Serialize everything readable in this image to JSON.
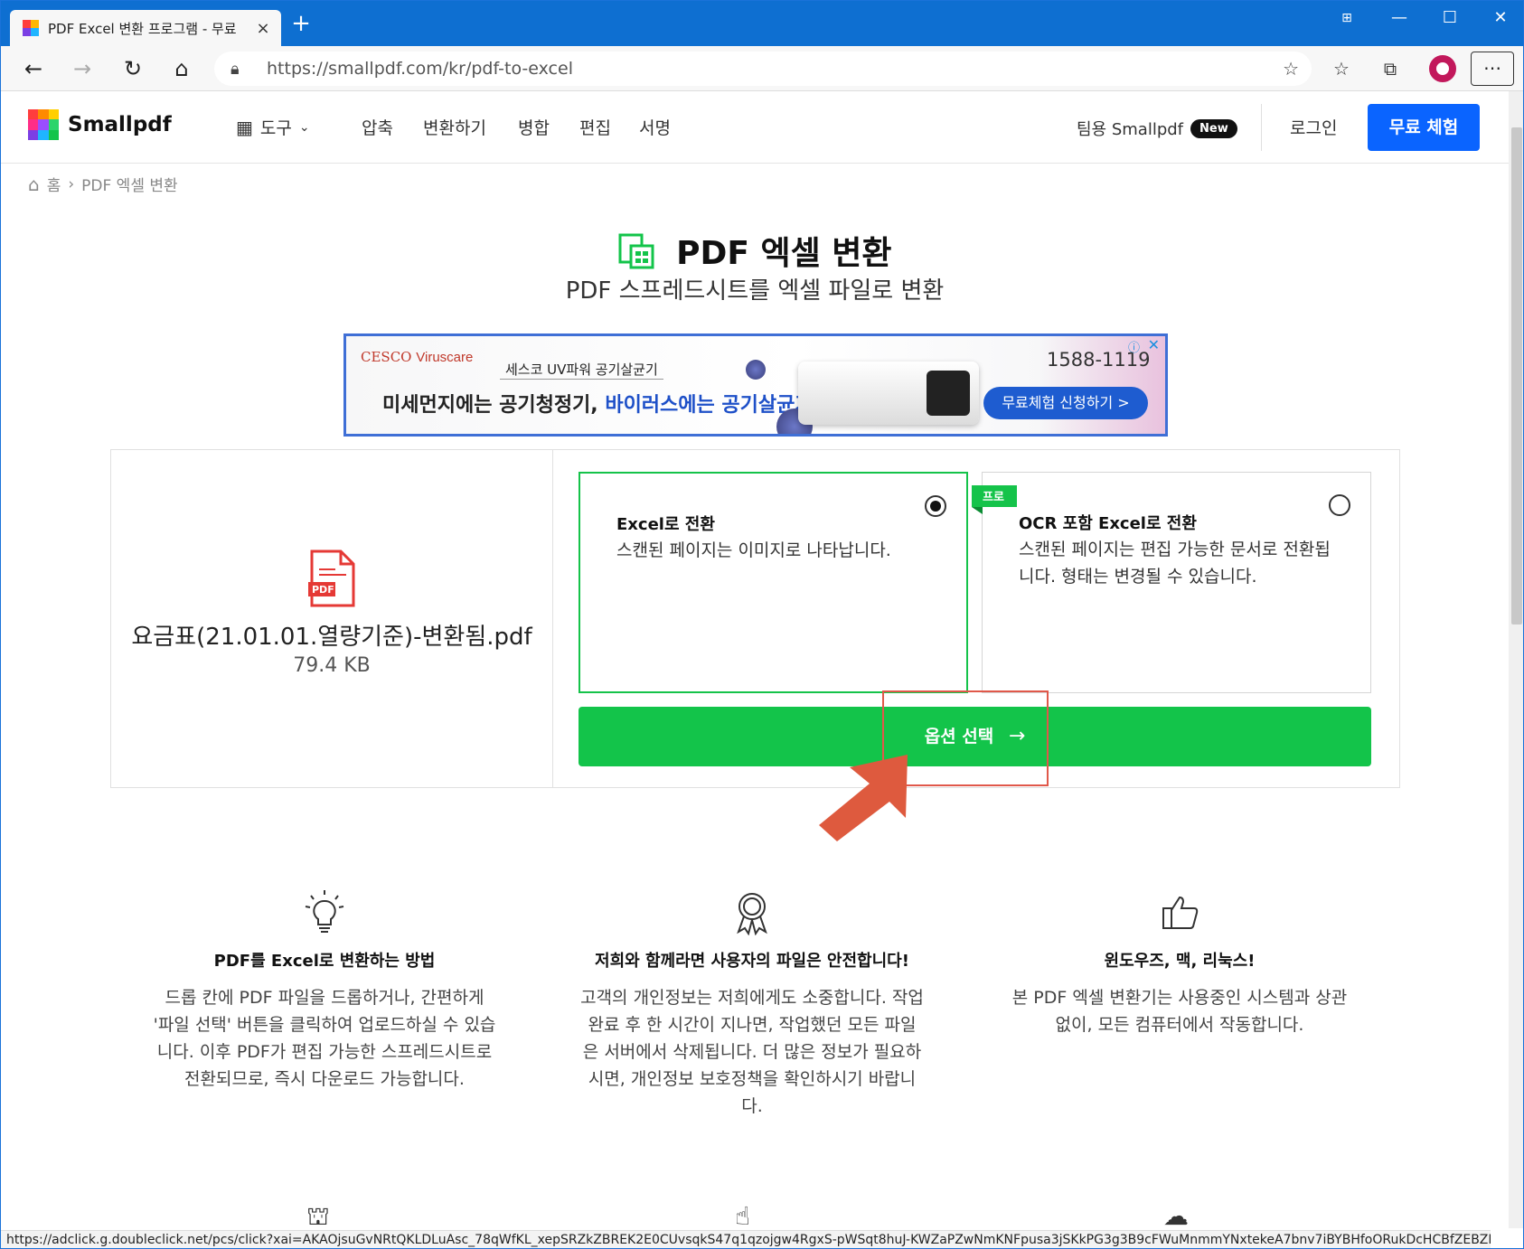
{
  "browser": {
    "tab_title": "PDF Excel 변환 프로그램 - 무료",
    "tab_close": "×",
    "new_tab": "+",
    "url": "https://smallpdf.com/kr/pdf-to-excel",
    "status_url": "https://adclick.g.doubleclick.net/pcs/click?xai=AKAOjsuGvNRtQKLDLuAsc_78qWfKL_xepSRZkZBREK2E0CUvsqkS47q1qzojgw4RgxS-pWSqt8huJ-KWZaPZwNmKNFpusa3jSKkPG3g3B9cFWuMnmmYNxtekeA7bnv7iBYBHfoORukDcHCBfZEBZMgAuMo..."
  },
  "header": {
    "logo_text": "Smallpdf",
    "nav": {
      "tools": "도구",
      "compress": "압축",
      "convert": "변환하기",
      "merge": "병합",
      "edit": "편집",
      "sign": "서명"
    },
    "team": "팀용 Smallpdf",
    "team_badge": "New",
    "login": "로그인",
    "trial": "무료 체험"
  },
  "breadcrumb": {
    "home": "홈",
    "sep": "›",
    "current": "PDF 엑셀 변환"
  },
  "hero": {
    "title": "PDF 엑셀 변환",
    "subtitle": "PDF 스프레드시트를 엑셀 파일로 변환"
  },
  "ad": {
    "brand": "CESCO",
    "brand_sub": "Viruscare",
    "tag": "세스코 UV파워 공기살균기",
    "headline_a": "미세먼지에는 공기청정기, ",
    "headline_b": "바이러스에는 공기살균기!",
    "phone": "1588-1119",
    "cta": "무료체험 신청하기 >",
    "adchoice": "ⓘ",
    "close": "✕"
  },
  "file": {
    "name": "요금표(21.01.01.열량기준)-변환됨.pdf",
    "size": "79.4 KB",
    "icon_label": "PDF"
  },
  "options": [
    {
      "title": "Excel로 전환",
      "desc": "스캔된 페이지는 이미지로 나타납니다.",
      "selected": true
    },
    {
      "badge": "프로",
      "title": "OCR 포함 Excel로 전환",
      "desc": "스캔된 페이지는 편집 가능한 문서로 전환됩니다. 형태는 변경될 수 있습니다.",
      "selected": false
    }
  ],
  "select_button": "옵션 선택",
  "features": [
    {
      "title": "PDF를 Excel로 변환하는 방법",
      "desc": "드롭 칸에 PDF 파일을 드롭하거나, 간편하게 '파일 선택' 버튼을 클릭하여 업로드하실 수 있습니다. 이후 PDF가 편집 가능한 스프레드시트로 전환되므로, 즉시 다운로드 가능합니다."
    },
    {
      "title": "저희와 함께라면 사용자의 파일은 안전합니다!",
      "desc": "고객의 개인정보는 저희에게도 소중합니다. 작업 완료 후 한 시간이 지나면, 작업했던 모든 파일은 서버에서 삭제됩니다. 더 많은 정보가 필요하시면, 개인정보 보호정책을 확인하시기 바랍니다."
    },
    {
      "title": "윈도우즈, 맥, 리눅스!",
      "desc": "본 PDF 엑셀 변환기는 사용중인 시스템과 상관 없이, 모든 컴퓨터에서 작동합니다."
    }
  ],
  "colors": {
    "accent_blue": "#0a64ff",
    "green": "#13c44a",
    "highlight_red": "#e0584a"
  }
}
